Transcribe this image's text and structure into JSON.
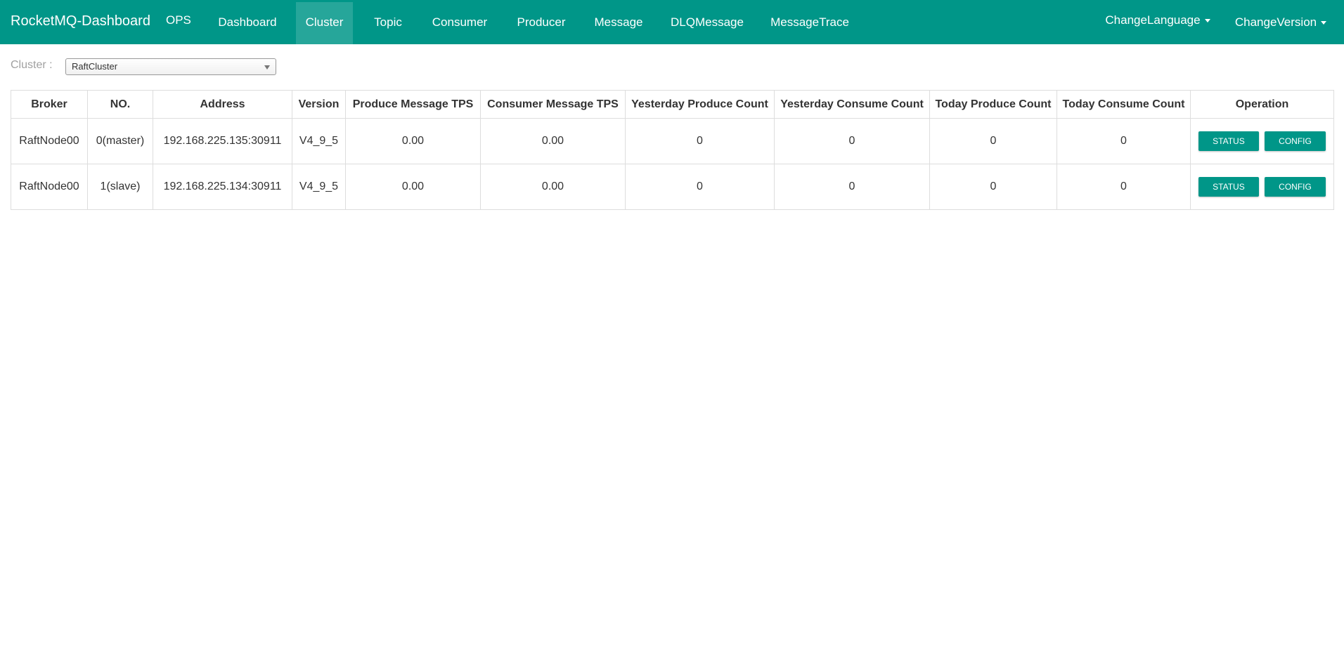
{
  "navbar": {
    "brand": "RocketMQ-Dashboard",
    "items": [
      {
        "label": "OPS"
      },
      {
        "label": "Dashboard"
      },
      {
        "label": "Cluster"
      },
      {
        "label": "Topic"
      },
      {
        "label": "Consumer"
      },
      {
        "label": "Producer"
      },
      {
        "label": "Message"
      },
      {
        "label": "DLQMessage"
      },
      {
        "label": "MessageTrace"
      }
    ],
    "active": "Cluster",
    "change_language": "ChangeLanguage",
    "change_version": "ChangeVersion",
    "color": "#009688",
    "active_color": "#26a69a"
  },
  "cluster_filter": {
    "label": "Cluster :",
    "selected": "RaftCluster"
  },
  "table": {
    "headers": [
      "Broker",
      "NO.",
      "Address",
      "Version",
      "Produce Message TPS",
      "Consumer Message TPS",
      "Yesterday Produce Count",
      "Yesterday Consume Count",
      "Today Produce Count",
      "Today Consume Count",
      "Operation"
    ],
    "rows": [
      {
        "broker": "RaftNode00",
        "no": "0(master)",
        "address": "192.168.225.135:30911",
        "version": "V4_9_5",
        "produce_tps": "0.00",
        "consumer_tps": "0.00",
        "yesterday_produce": "0",
        "yesterday_consume": "0",
        "today_produce": "0",
        "today_consume": "0",
        "status_btn": "STATUS",
        "config_btn": "CONFIG"
      },
      {
        "broker": "RaftNode00",
        "no": "1(slave)",
        "address": "192.168.225.134:30911",
        "version": "V4_9_5",
        "produce_tps": "0.00",
        "consumer_tps": "0.00",
        "yesterday_produce": "0",
        "yesterday_consume": "0",
        "today_produce": "0",
        "today_consume": "0",
        "status_btn": "STATUS",
        "config_btn": "CONFIG"
      }
    ]
  },
  "colors": {
    "accent": "#009688",
    "border": "#dddddd"
  }
}
